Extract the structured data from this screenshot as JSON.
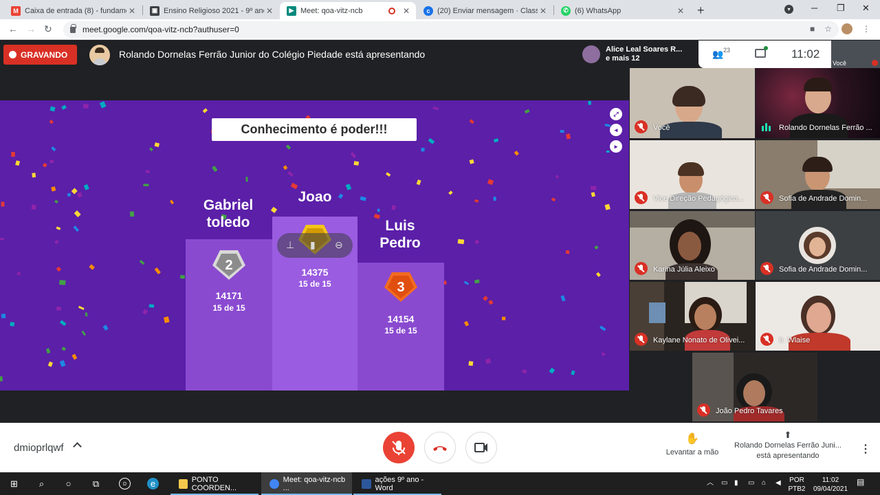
{
  "browser": {
    "tabs": [
      {
        "label": "Caixa de entrada (8) - fundament",
        "icon": "gmail-icon",
        "color": "#ea4335"
      },
      {
        "label": "Ensino Religioso 2021 - 9º ano de",
        "icon": "classroom-icon",
        "color": "#202124"
      },
      {
        "label": "Meet: qoa-vitz-ncb",
        "icon": "meet-icon",
        "color": "#00897b",
        "active": true
      },
      {
        "label": "(20) Enviar mensagem · ClassApp",
        "icon": "classapp-icon",
        "color": "#1a73e8"
      },
      {
        "label": "(6) WhatsApp",
        "icon": "whatsapp-icon",
        "color": "#25d366"
      }
    ],
    "url": "meet.google.com/qoa-vitz-ncb?authuser=0"
  },
  "meet": {
    "recording_label": "GRAVANDO",
    "presenting_text": "Rolando Dornelas Ferrão Junior do Colégio Piedade está apresentando",
    "notification": {
      "line1": "Alice Leal Soares R...",
      "line2": "e mais 12"
    },
    "participants_count": "23",
    "clock": "11:02",
    "self_label": "Você"
  },
  "presentation": {
    "title": "Conhecimento é poder!!!",
    "podium": [
      {
        "name_line1": "Gabriel",
        "name_line2": "toledo",
        "rank": "2",
        "score": "14171",
        "fraction": "15 de 15"
      },
      {
        "name_line1": "Joao",
        "name_line2": "",
        "rank": "1",
        "score": "14375",
        "fraction": "15 de 15"
      },
      {
        "name_line1": "Luis",
        "name_line2": "Pedro",
        "rank": "3",
        "score": "14154",
        "fraction": "15 de 15"
      }
    ]
  },
  "tiles": [
    {
      "name": "Você",
      "status": "muted"
    },
    {
      "name": "Rolando Dornelas Ferrão ...",
      "status": "speaking"
    },
    {
      "name": "Vice Direção Pedagógica...",
      "status": "muted"
    },
    {
      "name": "Sofia de Andrade Domin...",
      "status": "muted"
    },
    {
      "name": "Karina Júlia Aleixo",
      "status": "muted"
    },
    {
      "name": "Sofia de Andrade Domin...",
      "status": "muted"
    },
    {
      "name": "Kaylane Nonato de Olivei...",
      "status": "muted"
    },
    {
      "name": "Ir. Wlaise",
      "status": "muted"
    },
    {
      "name": "João Pedro Tavares",
      "status": "muted"
    }
  ],
  "callbar": {
    "meeting_code": "dmioprlqwf",
    "raise_hand": "Levantar a mão",
    "presenting_line1": "Rolando Dornelas Ferrão Juni...",
    "presenting_line2": "está apresentando"
  },
  "taskbar": {
    "apps": [
      {
        "label": "PONTO COORDEN...",
        "icon": "folder-icon",
        "color": "#f2c94c"
      },
      {
        "label": "Meet: qoa-vitz-ncb ...",
        "icon": "chrome-icon",
        "color": "#4285f4",
        "active": true
      },
      {
        "label": "ações 9º ano - Word",
        "icon": "word-icon",
        "color": "#2b579a"
      }
    ],
    "language_line1": "POR",
    "language_line2": "PTB2",
    "time": "11:02",
    "date": "09/04/2021"
  }
}
